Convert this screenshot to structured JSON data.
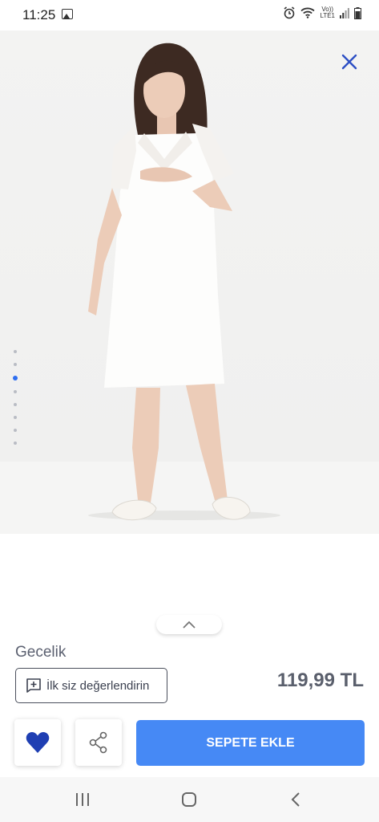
{
  "status_bar": {
    "time": "11:25",
    "network_top": "Vo))",
    "network_bottom": "LTE1"
  },
  "hero": {
    "image_description_icon": "product-photo",
    "carousel": {
      "total": 8,
      "active_index": 2
    }
  },
  "product": {
    "name": "Gecelik",
    "review_button_label": "İlk siz değerlendirin",
    "price": "119,99 TL"
  },
  "actions": {
    "add_to_cart_label": "SEPETE EKLE"
  },
  "colors": {
    "accent": "#4689f5",
    "heart": "#1f3fb3",
    "close_icon": "#2d4fc4"
  },
  "icons": {
    "close": "close-icon",
    "collapse": "chevron-up-icon",
    "review": "add-comment-icon",
    "favorite": "heart-icon",
    "share": "share-icon"
  }
}
